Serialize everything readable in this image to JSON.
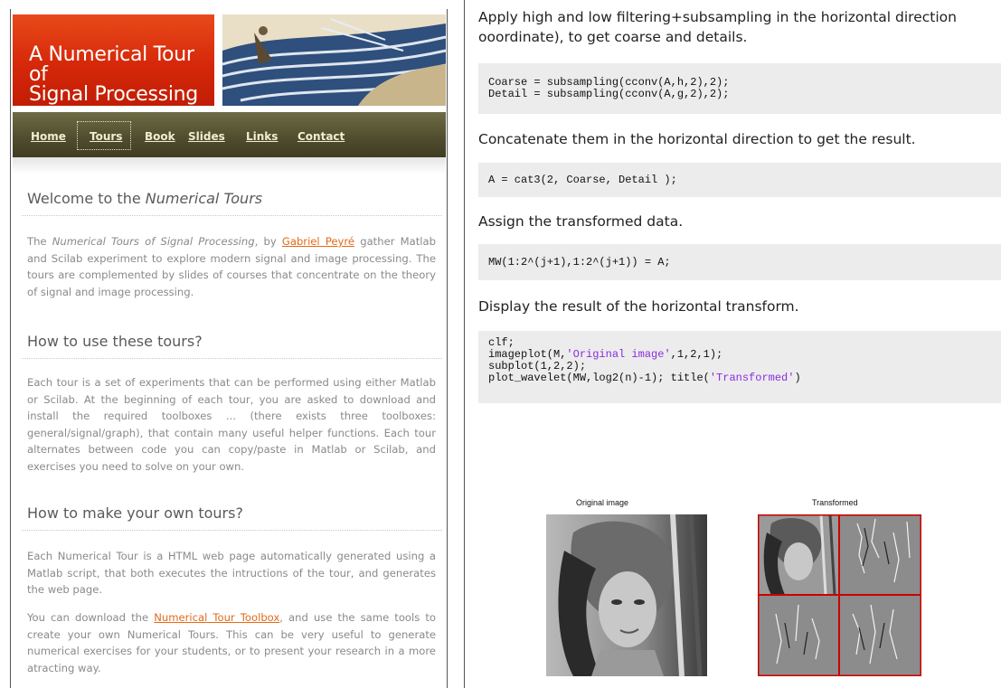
{
  "left": {
    "logo_line1": "A Numerical Tour of",
    "logo_line2": "Signal Processing",
    "nav": [
      "Home",
      "Tours",
      "Book",
      "Slides",
      "Links",
      "Contact"
    ],
    "nav_active": "Tours",
    "sections": [
      {
        "heading_prefix": "Welcome to the ",
        "heading_em": "Numerical Tours",
        "para_parts": {
          "pre": "The ",
          "em": "Numerical Tours of Signal Processing",
          "mid": ", by ",
          "link": "Gabriel Peyré",
          "post": " gather Matlab and Scilab experiment to explore modern signal and image processing. The tours are complemented by slides of courses that concentrate on the theory of signal and image processing."
        }
      },
      {
        "heading": "How to use these tours?",
        "para": "Each tour is a set of experiments that can be performed using either Matlab or Scilab. At the beginning of each tour, you are asked to download and install the required toolboxes ... (there exists three toolboxes: general/signal/graph), that contain many useful helper functions. Each tour alternates between code you can copy/paste in Matlab or Scilab, and exercises you need to solve on your own."
      },
      {
        "heading": "How to make your own tours?",
        "para1": "Each Numerical Tour is a HTML web page automatically generated using a Matlab script, that both executes the intructions of the tour, and generates the web page.",
        "para2_pre": "You can download the ",
        "para2_link": "Numerical Tour Toolbox",
        "para2_post": ", and use the same tools to create your own Numerical Tours. This can be very useful to generate numerical exercises for your students, or to present your research in a more atracting way."
      }
    ]
  },
  "right": {
    "text1_line1": "Apply high and low filtering+subsampling in the horizontal direction",
    "text1_line2": "ooordinate), to get coarse and details.",
    "code1_line1": "Coarse = subsampling(cconv(A,h,2),2);",
    "code1_line2": "Detail = subsampling(cconv(A,g,2),2);",
    "text2": "Concatenate them in the horizontal direction to get the result.",
    "code2": "A = cat3(2, Coarse, Detail );",
    "text3": "Assign the transformed data.",
    "code3": "MW(1:2^(j+1),1:2^(j+1)) = A;",
    "text4": "Display the result of the horizontal transform.",
    "code4_line1": "clf;",
    "code4_line2_pre": "imageplot(M,",
    "code4_line2_str": "'Original image'",
    "code4_line2_post": ",1,2,1);",
    "code4_line3": "subplot(1,2,2);",
    "code4_line4_pre": "plot_wavelet(MW,log2(n)-1); title(",
    "code4_line4_str": "'Transformed'",
    "code4_line4_post": ")",
    "fig_title_left": "Original image",
    "fig_title_right": "Transformed",
    "grid_color": "#cc0000"
  }
}
